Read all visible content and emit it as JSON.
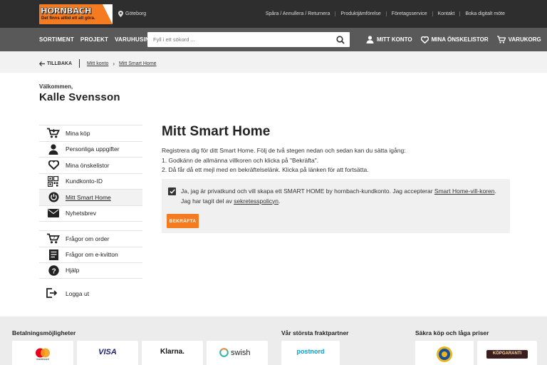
{
  "header": {
    "logo_name": "HORNBACH",
    "logo_tagline": "Det finns alltid ett att göra.",
    "store": "Göteborg",
    "top_links": [
      "Spåra / Annullera / Returnera",
      "Produktjämförelse",
      "Företagsservice",
      "Kontakt",
      "Boka digitalt möte"
    ]
  },
  "nav": {
    "items": [
      "SORTIMENT",
      "PROJEKT",
      "VARUHUSINFO"
    ],
    "search_placeholder": "Fyll i ett sökord ...",
    "my_account": "MITT KONTO",
    "wishlists": "MINA ÖNSKELISTOR",
    "cart": "VARUKORG"
  },
  "breadcrumb": {
    "back": "TILLBAKA",
    "my_account": "Mitt konto",
    "current": "Mitt Smart Home"
  },
  "user": {
    "welcome": "Välkommen,",
    "name": "Kalle Svensson"
  },
  "sidebar": {
    "group1": [
      {
        "label": "Mina köp",
        "icon": "cart-icon"
      },
      {
        "label": "Personliga uppgifter",
        "icon": "person-icon"
      },
      {
        "label": "Mina önskelistor",
        "icon": "heart-icon"
      },
      {
        "label": "Kundkonto-ID",
        "icon": "qr-code-icon"
      },
      {
        "label": "Mitt Smart Home",
        "icon": "power-icon"
      },
      {
        "label": "Nyhetsbrev",
        "icon": "envelope-icon"
      }
    ],
    "group2": [
      {
        "label": "Frågor om order",
        "icon": "cart-question-icon"
      },
      {
        "label": "Frågor om e-kvitton",
        "icon": "receipt-icon"
      },
      {
        "label": "Hjälp",
        "icon": "help-icon"
      }
    ],
    "logout": "Logga ut"
  },
  "main": {
    "title": "Mitt Smart Home",
    "description_line1": "Registrera dig för ditt Smart Home. Följ de två stegen nedan och sedan kan du sätta igång:",
    "description_line2": "1. Godkänn de allmänna villkoren och klicka på \"Bekräfta\".",
    "description_line3": "2. Då får då ett mejl med en bekräftelselänk. Klicka på länken för att fortsätta.",
    "consent_part1": "Ja, jag är privatkund och vill skapa ett SMART HOME by hornbach-kundkonto. Jag accepterar ",
    "consent_link1": "Smart Home-vill-koren",
    "consent_part2": ". Jag har tagit del av ",
    "consent_link2": "sekretesspolicyn",
    "consent_part3": ".",
    "consent_checked": true,
    "confirm_button": "BEKRÄFTA"
  },
  "footer": {
    "payment_heading": "Betalningsmöjligheter",
    "shipping_heading": "Vår största fraktpartner",
    "secure_heading": "Säkra köp och låga priser",
    "payment_methods": [
      "mastercard",
      "VISA",
      "Klarna.",
      "swish"
    ],
    "shipping_partner": "postnord",
    "secure_badge": "KÖPGARANTI"
  },
  "colors": {
    "accent": "#f47b20",
    "topbar": "#2e2e2e",
    "navbar": "#595959"
  }
}
